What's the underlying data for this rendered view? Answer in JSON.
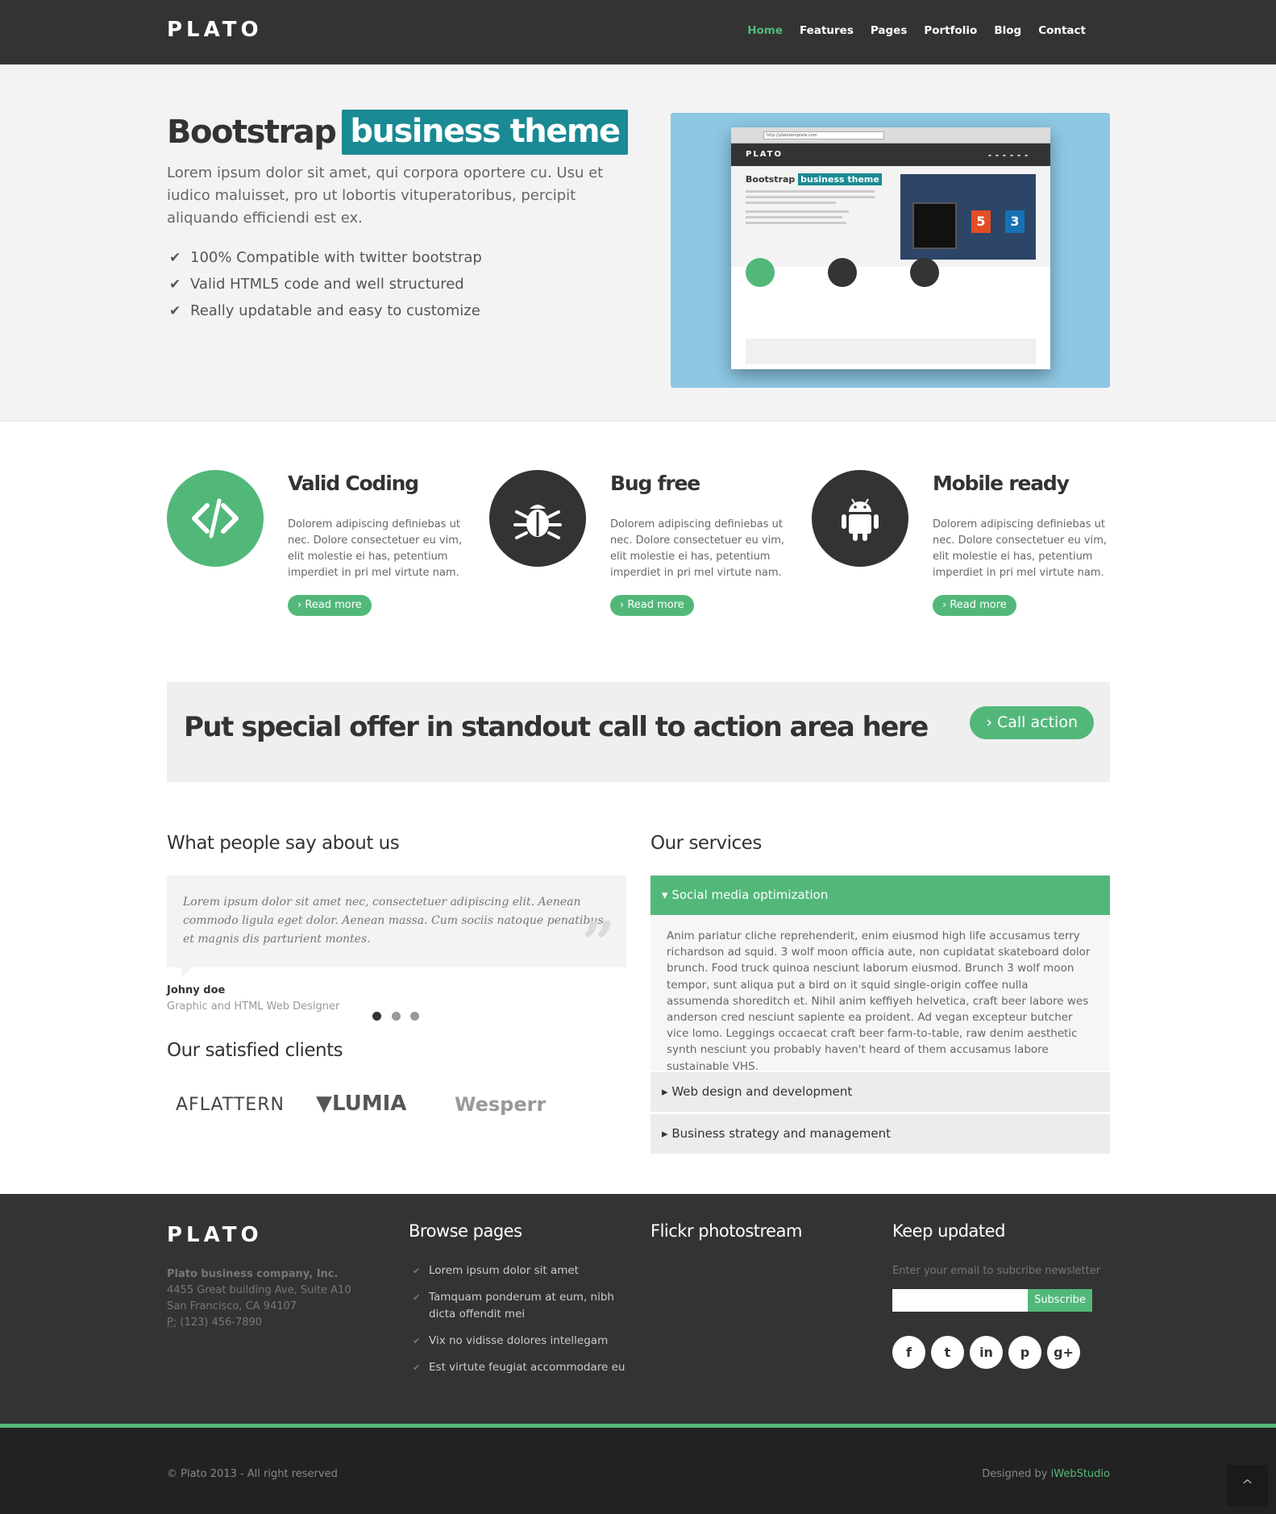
{
  "nav": {
    "brand": "PLATO",
    "items": [
      "Home",
      "Features",
      "Pages",
      "Portfolio",
      "Blog",
      "Contact"
    ],
    "active": "Home"
  },
  "hero": {
    "title": "Bootstrap",
    "title_highlight": "business theme",
    "lead": "Lorem ipsum dolor sit amet, qui corpora oportere cu. Usu et iudico maluisset, pro ut lobortis vituperatoribus, percipit aliquando efficiendi est ex.",
    "checks": [
      "100% Compatible with twitter bootstrap",
      "Valid HTML5 code and well structured",
      "Really updatable and easy to customize"
    ],
    "mockup": {
      "url": "http://platotemplate.com",
      "brand": "PLATO",
      "title": "Bootstrap",
      "title_highlight": "business theme"
    }
  },
  "features": [
    {
      "title": "Valid Coding",
      "text": "Dolorem adipiscing definiebas ut nec. Dolore consectetuer eu vim, elit molestie ei has, petentium imperdiet in pri mel virtute nam.",
      "button": "› Read more",
      "icon": "code-icon",
      "color": "#52b87a"
    },
    {
      "title": "Bug free",
      "text": "Dolorem adipiscing definiebas ut nec. Dolore consectetuer eu vim, elit molestie ei has, petentium imperdiet in pri mel virtute nam.",
      "button": "› Read more",
      "icon": "bug-icon",
      "color": "#333333"
    },
    {
      "title": "Mobile ready",
      "text": "Dolorem adipiscing definiebas ut nec. Dolore consectetuer eu vim, elit molestie ei has, petentium imperdiet in pri mel virtute nam.",
      "button": "› Read more",
      "icon": "android-icon",
      "color": "#333333"
    }
  ],
  "cta": {
    "text": "Put special offer in standout call to action area here",
    "button": "› Call action"
  },
  "testimonials": {
    "title": "What people say about us",
    "quote": "Lorem ipsum dolor sit amet nec, consectetuer adipiscing elit. Aenean commodo ligula eget dolor. Aenean massa. Cum sociis natoque penatibus et magnis dis parturient montes.",
    "author": "Johny doe",
    "role": "Graphic and HTML Web Designer"
  },
  "clients": {
    "title": "Our satisfied clients",
    "logos": [
      "AFLATTERN",
      "LUMIA",
      "Wesperr"
    ]
  },
  "services": {
    "title": "Our services",
    "items": [
      {
        "label": "Social media optimization",
        "body": "Anim pariatur cliche reprehenderit, enim eiusmod high life accusamus terry richardson ad squid. 3 wolf moon officia aute, non cupidatat skateboard dolor brunch. Food truck quinoa nesciunt laborum eiusmod. Brunch 3 wolf moon tempor, sunt aliqua put a bird on it squid single-origin coffee nulla assumenda shoreditch et. Nihil anim keffiyeh helvetica, craft beer labore wes anderson cred nesciunt sapiente ea proident. Ad vegan excepteur butcher vice lomo. Leggings occaecat craft beer farm-to-table, raw denim aesthetic synth nesciunt you probably haven't heard of them accusamus labore sustainable VHS."
      },
      {
        "label": "Web design and development"
      },
      {
        "label": "Business strategy and management"
      }
    ]
  },
  "footer": {
    "brand": "PLATO",
    "company": "Plato business company, Inc.",
    "address1": "4455 Great building Ave, Suite A10",
    "address2": "San Francisco, CA 94107",
    "phone_label": "P:",
    "phone": "(123) 456-7890",
    "browse_title": "Browse pages",
    "browse_links": [
      "Lorem ipsum dolor sit amet",
      "Tamquam ponderum at eum, nibh dicta offendit mei",
      "Vix no vidisse dolores intellegam",
      "Est virtute feugiat accommodare eu"
    ],
    "flickr_title": "Flickr photostream",
    "updated_title": "Keep updated",
    "newsletter_text": "Enter your email to subcribe newsletter",
    "subscribe": "Subscribe",
    "social": [
      "f",
      "t",
      "in",
      "p",
      "g+"
    ]
  },
  "bottom": {
    "copyright": "© Plato 2013 - All right reserved",
    "designed_by": "Designed by",
    "designer": "iWebStudio",
    "to_top": "^"
  },
  "colors": {
    "accent": "#52b87a",
    "teal": "#1a8a94",
    "dark": "#333333"
  }
}
